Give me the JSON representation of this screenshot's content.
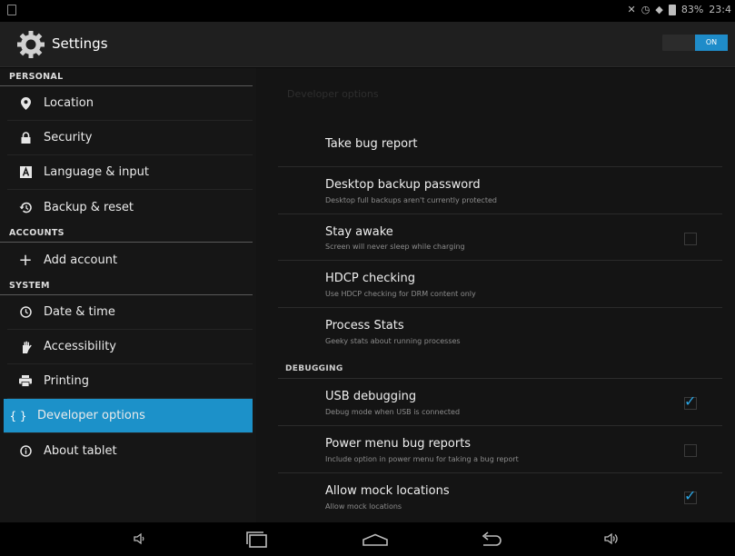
{
  "status_bar": {
    "battery": "83%",
    "time": "23:4"
  },
  "action_bar": {
    "title": "Settings",
    "toggle_label": "ON"
  },
  "sidebar": {
    "categories": [
      "PERSONAL",
      "ACCOUNTS",
      "SYSTEM"
    ],
    "items": [
      {
        "label": "Location",
        "icon": "location-pin-icon"
      },
      {
        "label": "Security",
        "icon": "lock-icon"
      },
      {
        "label": "Language & input",
        "icon": "keyboard-a-icon"
      },
      {
        "label": "Backup & reset",
        "icon": "restore-icon"
      },
      {
        "label": "Add account",
        "icon": "plus-icon"
      },
      {
        "label": "Date & time",
        "icon": "clock-icon"
      },
      {
        "label": "Accessibility",
        "icon": "hand-icon"
      },
      {
        "label": "Printing",
        "icon": "printer-icon"
      },
      {
        "label": "Developer options",
        "icon": "braces-icon",
        "selected": true
      },
      {
        "label": "About tablet",
        "icon": "info-icon"
      }
    ]
  },
  "main": {
    "header": "Developer options",
    "options": [
      {
        "title": "Take bug report",
        "subtitle": ""
      },
      {
        "title": "Desktop backup password",
        "subtitle": "Desktop full backups aren't currently protected"
      },
      {
        "title": "Stay awake",
        "subtitle": "Screen will never sleep while charging",
        "checked": false
      },
      {
        "title": "HDCP checking",
        "subtitle": "Use HDCP checking for DRM content only"
      },
      {
        "title": "Process Stats",
        "subtitle": "Geeky stats about running processes"
      }
    ],
    "debugging_category": "DEBUGGING",
    "debug_options": [
      {
        "title": "USB debugging",
        "subtitle": "Debug mode when USB is connected",
        "checked": true
      },
      {
        "title": "Power menu bug reports",
        "subtitle": "Include option in power menu for taking a bug report",
        "checked": false
      },
      {
        "title": "Allow mock locations",
        "subtitle": "Allow mock locations",
        "checked": true
      }
    ]
  },
  "nav_bar": {
    "buttons": [
      "volume-down-icon",
      "recent-apps-icon",
      "home-icon",
      "back-icon",
      "volume-up-icon"
    ]
  },
  "colors": {
    "accent": "#1c91c9",
    "check": "#2ba5e3"
  }
}
